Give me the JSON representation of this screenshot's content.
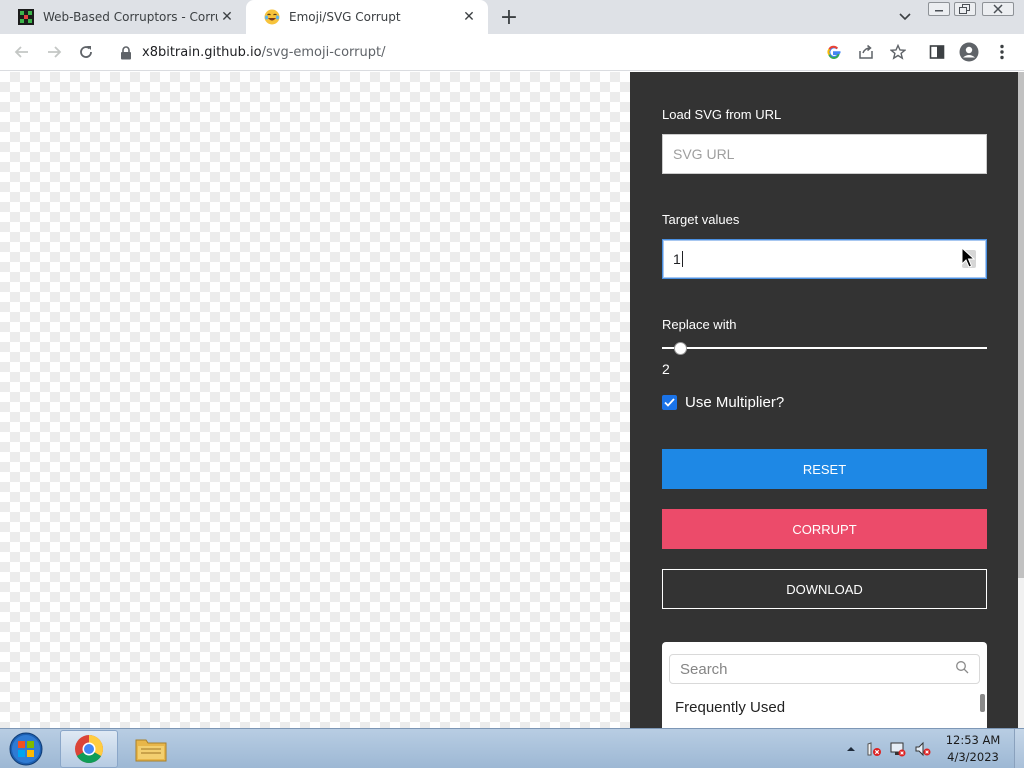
{
  "browser": {
    "tabs": [
      {
        "title": "Web-Based Corruptors - Corrupt",
        "favicon": "pixel-art-icon",
        "active": false
      },
      {
        "title": "Emoji/SVG Corrupt",
        "favicon": "laughing-emoji-icon",
        "active": true
      }
    ],
    "new_tab_label": "+",
    "address": {
      "host": "x8bitrain.github.io",
      "path": "/svg-emoji-corrupt/"
    }
  },
  "panel": {
    "load_svg_label": "Load SVG from URL",
    "svg_url_placeholder": "SVG URL",
    "svg_url_value": "",
    "target_values_label": "Target values",
    "target_values_value": "1",
    "replace_with_label": "Replace with",
    "replace_with_value": "2",
    "replace_slider_fraction": 0.04,
    "use_multiplier_label": "Use Multiplier?",
    "use_multiplier_checked": true,
    "reset_label": "RESET",
    "corrupt_label": "CORRUPT",
    "download_label": "DOWNLOAD",
    "emoji_picker": {
      "search_placeholder": "Search",
      "section_label": "Frequently Used"
    }
  },
  "colors": {
    "panel_bg": "#333333",
    "reset_button": "#1e88e5",
    "corrupt_button": "#ec4b6a",
    "checkbox_accent": "#1a73e8"
  },
  "taskbar": {
    "items": [
      "start-orb-icon",
      "chrome-icon",
      "file-explorer-icon"
    ],
    "clock_time": "12:53 AM",
    "clock_date": "4/3/2023"
  }
}
